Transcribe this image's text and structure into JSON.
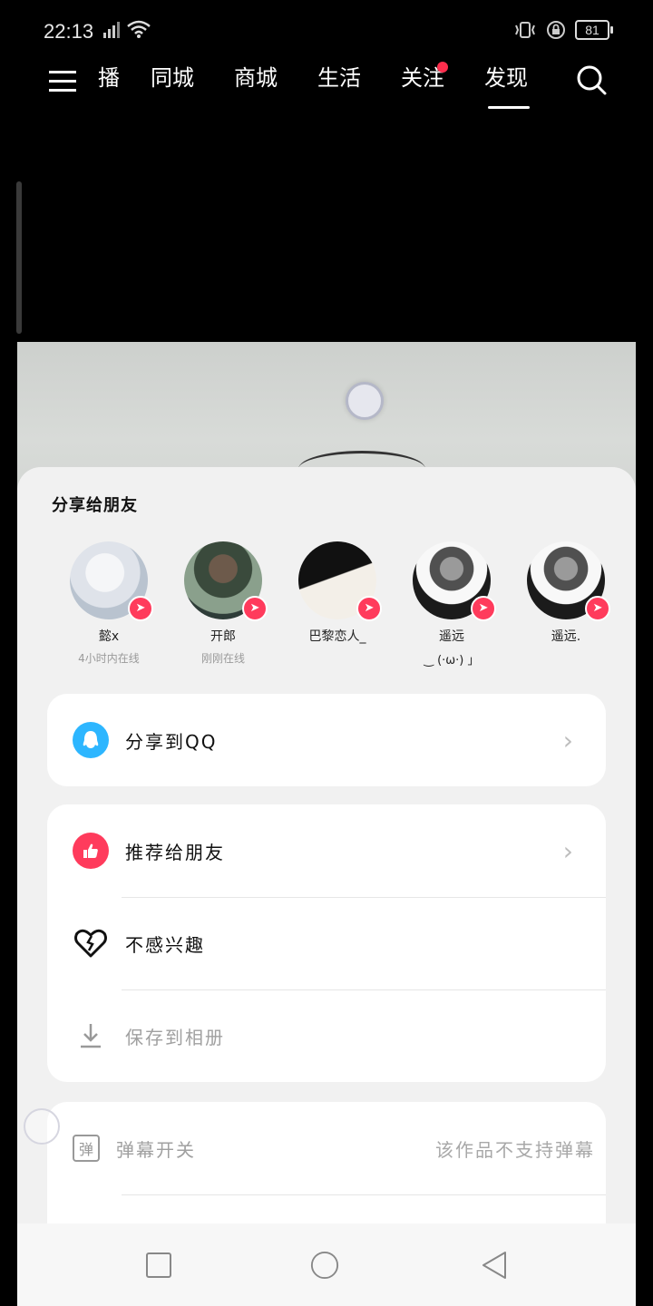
{
  "status_bar": {
    "time": "22:13",
    "battery": "81"
  },
  "top_nav": {
    "tabs": [
      {
        "label": "播"
      },
      {
        "label": "同城"
      },
      {
        "label": "商城"
      },
      {
        "label": "生活"
      },
      {
        "label": "关注",
        "has_dot": true
      },
      {
        "label": "发现",
        "active": true
      }
    ]
  },
  "share_sheet": {
    "title": "分享给朋友",
    "friends": [
      {
        "name": "懿x",
        "status": "4小时内在线"
      },
      {
        "name": "开郎",
        "status": "刚刚在线"
      },
      {
        "name": "巴黎恋人_",
        "status": ""
      },
      {
        "name": "遥远",
        "status": "",
        "extra": "‿ (·ω·) 」"
      },
      {
        "name": "遥远.",
        "status": ""
      },
      {
        "name": "",
        "status": ""
      }
    ],
    "share_qq": {
      "label": "分享到QQ",
      "icon": "qq-icon"
    },
    "actions": [
      {
        "label": "推荐给朋友",
        "icon": "thumbs-up-icon"
      },
      {
        "label": "不感兴趣",
        "icon": "broken-heart-icon"
      },
      {
        "label": "保存到相册",
        "icon": "download-icon"
      }
    ],
    "danmaku": {
      "label": "弹幕开关",
      "icon_text": "弹",
      "note": "该作品不支持弹幕"
    }
  },
  "colors": {
    "accent_red": "#ff3b5c",
    "qq_blue": "#2db6ff",
    "sheet_bg": "#f1f1f1"
  }
}
